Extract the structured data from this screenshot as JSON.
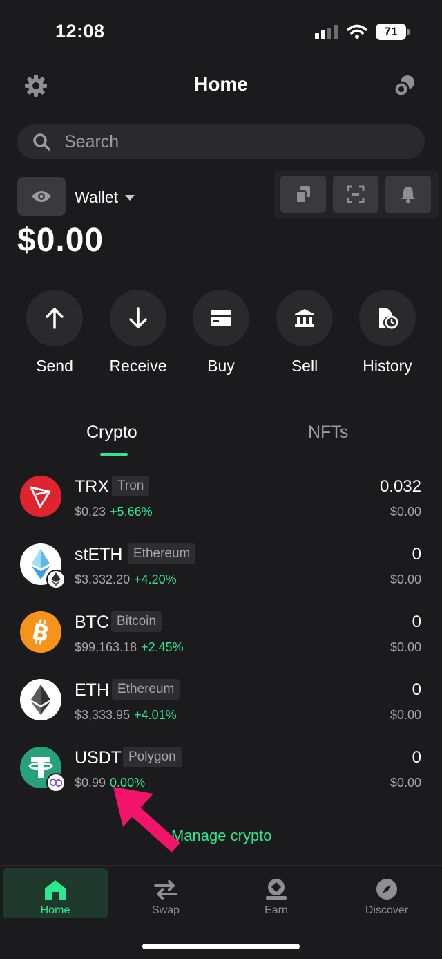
{
  "status_bar": {
    "time": "12:08",
    "battery": "71"
  },
  "header": {
    "title": "Home"
  },
  "search": {
    "placeholder": "Search"
  },
  "wallet": {
    "name": "Wallet",
    "balance": "$0.00"
  },
  "actions": [
    {
      "label": "Send",
      "icon": "arrow-up-icon"
    },
    {
      "label": "Receive",
      "icon": "arrow-down-icon"
    },
    {
      "label": "Buy",
      "icon": "card-icon"
    },
    {
      "label": "Sell",
      "icon": "bank-icon"
    },
    {
      "label": "History",
      "icon": "history-icon"
    }
  ],
  "tabs": {
    "crypto": "Crypto",
    "nfts": "NFTs",
    "active": "Crypto"
  },
  "assets": [
    {
      "symbol": "TRX",
      "network": "Tron",
      "price": "$0.23",
      "change": "+5.66%",
      "amount": "0.032",
      "value": "$0.00",
      "color": "#e0242f"
    },
    {
      "symbol": "stETH",
      "network": "Ethereum",
      "price": "$3,332.20",
      "change": "+4.20%",
      "amount": "0",
      "value": "$0.00",
      "color": "#ffffff"
    },
    {
      "symbol": "BTC",
      "network": "Bitcoin",
      "price": "$99,163.18",
      "change": "+2.45%",
      "amount": "0",
      "value": "$0.00",
      "color": "#f7931a"
    },
    {
      "symbol": "ETH",
      "network": "Ethereum",
      "price": "$3,333.95",
      "change": "+4.01%",
      "amount": "0",
      "value": "$0.00",
      "color": "#ffffff"
    },
    {
      "symbol": "USDT",
      "network": "Polygon",
      "price": "$0.99",
      "change": "0.00%",
      "amount": "0",
      "value": "$0.00",
      "color": "#26a17b"
    }
  ],
  "manage_label": "Manage crypto",
  "bottom_nav": [
    {
      "label": "Home",
      "active": true
    },
    {
      "label": "Swap",
      "active": false
    },
    {
      "label": "Earn",
      "active": false
    },
    {
      "label": "Discover",
      "active": false
    }
  ],
  "colors": {
    "accent": "#2ee88f",
    "background": "#1b1b1d",
    "annotation_arrow": "#f2146b"
  }
}
